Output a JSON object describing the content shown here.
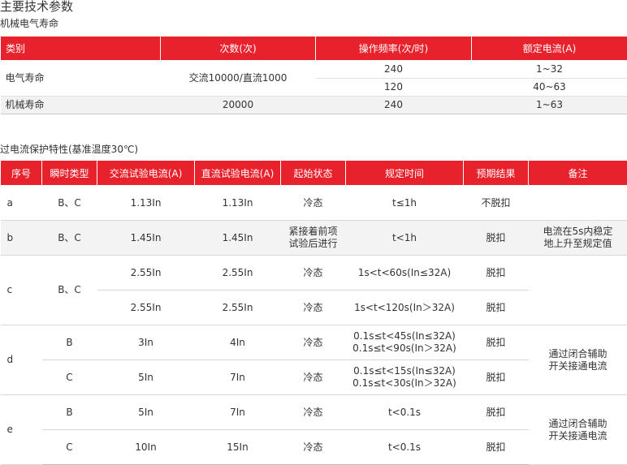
{
  "title": "主要技术参数",
  "table1": {
    "caption": "机械电气寿命",
    "headers": [
      "类别",
      "次数(次)",
      "操作频率(次/时)",
      "额定电流(A)"
    ],
    "electrical": {
      "category": "电气寿命",
      "count": "交流10000/直流1000",
      "rows": [
        {
          "freq": "240",
          "current": "1~32"
        },
        {
          "freq": "120",
          "current": "40~63"
        }
      ]
    },
    "mechanical": {
      "category": "机械寿命",
      "count": "20000",
      "freq": "240",
      "current": "1~63"
    }
  },
  "table2": {
    "caption": "过电流保护特性(基准温度30℃)",
    "headers": [
      "序号",
      "瞬时类型",
      "交流试验电流(A)",
      "直流试验电流(A)",
      "起始状态",
      "规定时间",
      "预期结果",
      "备注"
    ],
    "a": {
      "id": "a",
      "type": "B、C",
      "ac": "1.13In",
      "dc": "1.13In",
      "state": "冷态",
      "time": "t≤1h",
      "result": "不脱扣"
    },
    "b": {
      "id": "b",
      "type": "B、C",
      "ac": "1.45In",
      "dc": "1.45In",
      "state": [
        "紧接着前项",
        "试验后进行"
      ],
      "time": "t<1h",
      "result": "脱扣",
      "note": [
        "电流在5s内稳定",
        "地上升至规定值"
      ]
    },
    "c": {
      "id": "c",
      "type": "B、C",
      "rows": [
        {
          "ac": "2.55In",
          "dc": "2.55In",
          "state": "冷态",
          "time": "1s<t<60s(In≤32A)",
          "result": "脱扣"
        },
        {
          "ac": "2.55In",
          "dc": "2.55In",
          "state": "冷态",
          "time": "1s<t<120s(In＞32A)",
          "result": "脱扣"
        }
      ]
    },
    "d": {
      "id": "d",
      "note": [
        "通过闭合辅助",
        "开关接通电流"
      ],
      "rows": [
        {
          "type": "B",
          "ac": "3In",
          "dc": "4In",
          "state": "冷态",
          "time": [
            "0.1s≤t<45s(In≤32A)",
            "0.1s≤t<90s(In＞32A)"
          ],
          "result": "脱扣"
        },
        {
          "type": "C",
          "ac": "5In",
          "dc": "7In",
          "state": "冷态",
          "time": [
            "0.1s≤t<15s(In≤32A)",
            "0.1s≤t<30s(In＞32A)"
          ],
          "result": "脱扣"
        }
      ]
    },
    "e": {
      "id": "e",
      "note": [
        "通过闭合辅助",
        "开关接通电流"
      ],
      "rows": [
        {
          "type": "B",
          "ac": "5In",
          "dc": "7In",
          "state": "冷态",
          "time": "t<0.1s",
          "result": "脱扣"
        },
        {
          "type": "C",
          "ac": "10In",
          "dc": "15In",
          "state": "冷态",
          "time": "t<0.1s",
          "result": "脱扣"
        }
      ]
    }
  }
}
